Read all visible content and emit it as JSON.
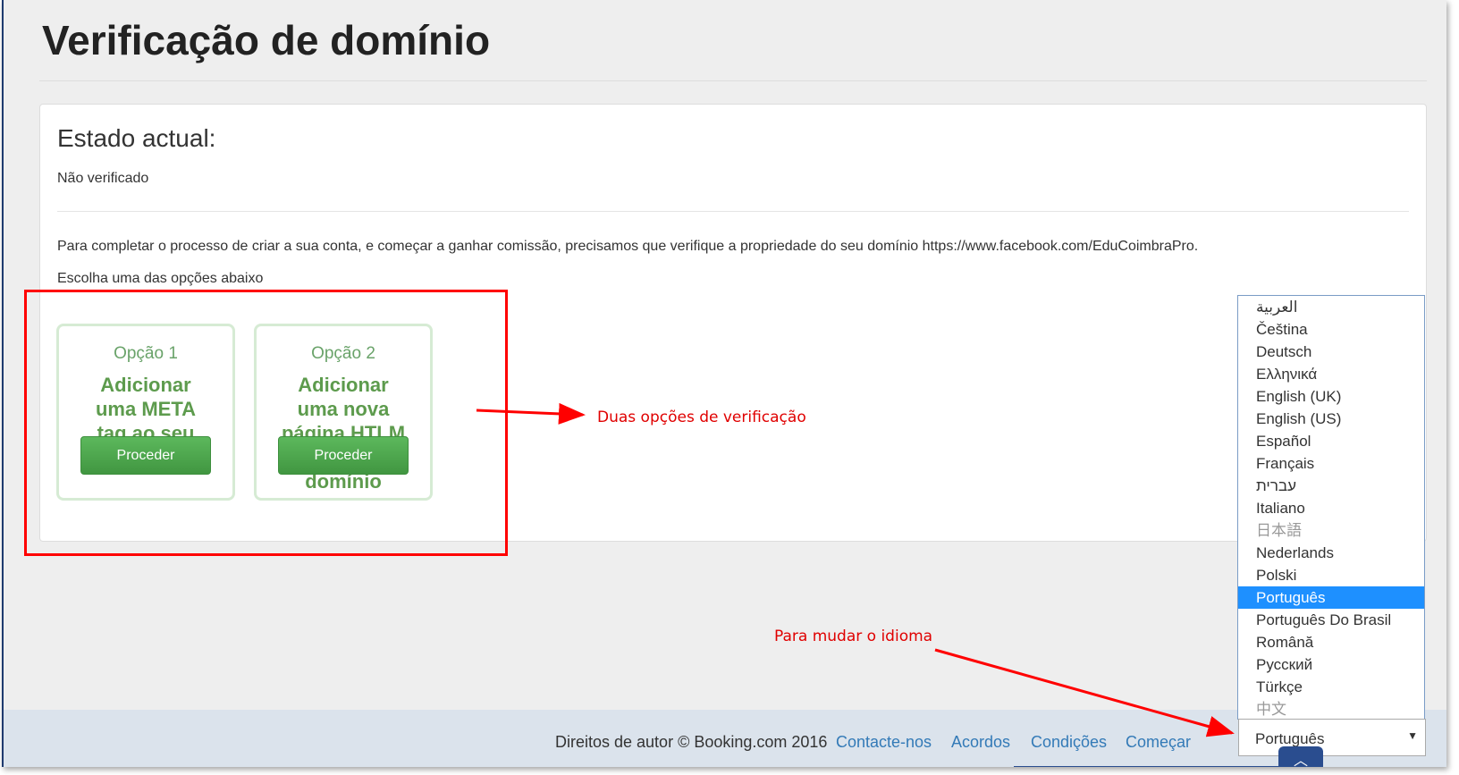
{
  "page": {
    "title": "Verificação de domínio"
  },
  "status": {
    "heading": "Estado actual:",
    "value": "Não verificado"
  },
  "description": "Para completar o processo de criar a sua conta, e começar a ganhar comissão, precisamos que verifique a propriedade do seu domínio https://www.facebook.com/EduCoimbraPro.",
  "choose_prompt": "Escolha uma das opções abaixo",
  "options": [
    {
      "label": "Opção 1",
      "text": "Adicionar uma META tag ao seu domínio",
      "button": "Proceder"
    },
    {
      "label": "Opção 2",
      "text": "Adicionar uma nova página HTLM ao seu domínio",
      "button": "Proceder"
    }
  ],
  "footer": {
    "copyright": "Direitos de autor © Booking.com 2016",
    "links": [
      "Contacte-nos",
      "Acordos",
      "Condições",
      "Começar"
    ]
  },
  "language": {
    "selected": "Português",
    "options": [
      {
        "label": "العربية",
        "faded": false
      },
      {
        "label": "Čeština",
        "faded": false
      },
      {
        "label": "Deutsch",
        "faded": false
      },
      {
        "label": "Ελληνικά",
        "faded": false
      },
      {
        "label": "English (UK)",
        "faded": false
      },
      {
        "label": "English (US)",
        "faded": false
      },
      {
        "label": "Español",
        "faded": false
      },
      {
        "label": "Français",
        "faded": false
      },
      {
        "label": "עברית",
        "faded": false
      },
      {
        "label": "Italiano",
        "faded": false
      },
      {
        "label": "日本語",
        "faded": true
      },
      {
        "label": "Nederlands",
        "faded": false
      },
      {
        "label": "Polski",
        "faded": false
      },
      {
        "label": "Português",
        "faded": false
      },
      {
        "label": "Português Do Brasil",
        "faded": false
      },
      {
        "label": "Română",
        "faded": false
      },
      {
        "label": "Русский",
        "faded": false
      },
      {
        "label": "Türkçe",
        "faded": false
      },
      {
        "label": "中文",
        "faded": true
      }
    ]
  },
  "annotations": {
    "options_note": "Duas opções de verificação",
    "language_note": "Para mudar o idioma"
  },
  "colors": {
    "annotation": "#ff0000",
    "primary_button": "#5cb85c",
    "link": "#337ab7",
    "highlight": "#1e90ff"
  },
  "icons": {
    "scroll_top": "chevron-up-icon",
    "select_arrow": "caret-down-icon"
  }
}
